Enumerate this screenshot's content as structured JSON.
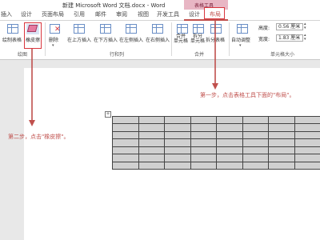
{
  "window": {
    "title": "新建 Microsoft Word 文档.docx - Word"
  },
  "context_group": {
    "label": "表格工具"
  },
  "tabs": [
    {
      "label": "插入"
    },
    {
      "label": "设计"
    },
    {
      "label": "页面布局"
    },
    {
      "label": "引用"
    },
    {
      "label": "邮件"
    },
    {
      "label": "审阅"
    },
    {
      "label": "视图"
    },
    {
      "label": "开发工具"
    },
    {
      "label": "设计"
    },
    {
      "label": "布局"
    }
  ],
  "ribbon": {
    "draw_group": {
      "label": "绘图",
      "draw_table": "绘制表格",
      "eraser": "橡皮擦"
    },
    "delete": "删除",
    "rows_cols": {
      "label": "行和列",
      "insert_above": "在上方插入",
      "insert_below": "在下方插入",
      "insert_left": "在左侧插入",
      "insert_right": "在右侧插入"
    },
    "merge": {
      "label": "合并",
      "merge_cells": "合并\n单元格",
      "split_cells": "拆分\n单元格",
      "split_table": "拆分表格"
    },
    "cell_size": {
      "label": "单元格大小",
      "autofit": "自动调整",
      "height_label": "高度:",
      "height_value": "0.56 厘米",
      "width_label": "宽度:",
      "width_value": "1.83 厘米"
    }
  },
  "annotations": {
    "step1": "第一步，点击表格工具下面的\"布局\"。",
    "step2": "第二步，点击\"橡皮擦\"。"
  },
  "table": {
    "rows": 7,
    "cols": 8,
    "anchor": "+"
  },
  "colors": {
    "annotation": "#c0504d",
    "highlight_box": "#d9363e",
    "context_tab": "#e8b6c4"
  }
}
